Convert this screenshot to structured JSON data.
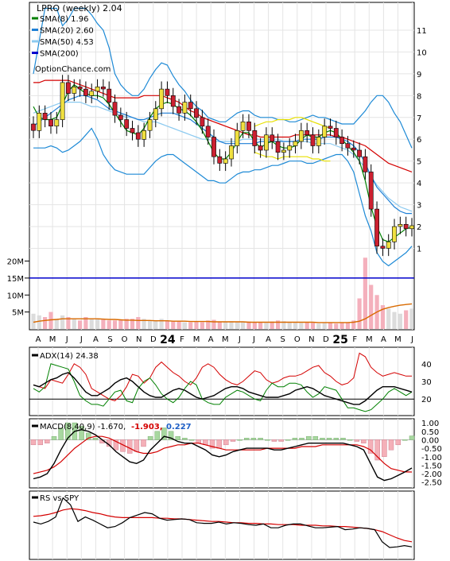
{
  "chart_data": {
    "type": "financial-composite",
    "ticker_label": "LPRO (weekly) 2.04",
    "watermark": "OptionChance.com",
    "colors": {
      "sma8": "#008000",
      "sma20": "#1e7fd6",
      "sma50": "#8ccaf0",
      "sma200": "#0000cc",
      "bb_upper_lower": "#1e8ad6",
      "envelope": "#e8e000",
      "red_line": "#d40000",
      "volume_avg": "#d96a00",
      "up_candle": "#f0e040",
      "down_candle": "#cc2030"
    },
    "x_axis": {
      "labels": [
        "A",
        "M",
        "J",
        "J",
        "A",
        "S",
        "O",
        "N",
        "D",
        "24",
        "F",
        "M",
        "A",
        "M",
        "J",
        "J",
        "A",
        "S",
        "O",
        "N",
        "D",
        "25",
        "F",
        "M",
        "A",
        "M",
        "J"
      ],
      "bold": [
        "24",
        "25"
      ]
    },
    "price_panel": {
      "legend": [
        {
          "label": "SMA(8) 1.96",
          "color": "#008000"
        },
        {
          "label": "SMA(20) 2.60",
          "color": "#1e7fd6"
        },
        {
          "label": "SMA(50) 4.53",
          "color": "#8ccaf0"
        },
        {
          "label": "SMA(200)",
          "color": "#0000cc"
        }
      ],
      "y_ticks": [
        "1",
        "2",
        "3",
        "4",
        "5",
        "6",
        "7",
        "8",
        "9",
        "10",
        "11"
      ],
      "y_range": [
        0,
        12.2
      ],
      "close": [
        6.4,
        7.2,
        6.9,
        6.6,
        6.9,
        8.6,
        8.1,
        8.4,
        8.3,
        8.0,
        8.2,
        8.4,
        8.3,
        7.7,
        7.1,
        6.9,
        6.5,
        6.3,
        6.0,
        6.4,
        6.9,
        7.4,
        8.3,
        8.0,
        7.5,
        7.2,
        7.7,
        7.4,
        7.0,
        6.6,
        6.1,
        5.2,
        4.9,
        5.1,
        5.7,
        6.4,
        6.8,
        6.4,
        5.7,
        5.5,
        6.2,
        5.9,
        5.4,
        5.5,
        5.7,
        5.9,
        6.4,
        6.2,
        5.7,
        6.1,
        6.6,
        6.5,
        6.1,
        5.8,
        5.6,
        5.5,
        5.2,
        4.5,
        2.8,
        1.1,
        1.0,
        1.3,
        2.0,
        2.1,
        1.9,
        2.04
      ],
      "sma8": [
        7.5,
        7.0,
        6.9,
        6.9,
        7.0,
        7.6,
        8.2,
        8.5,
        8.3,
        8.1,
        8.0,
        8.0,
        7.9,
        7.6,
        7.2,
        6.8,
        6.4,
        6.3,
        6.2,
        6.5,
        7.0,
        7.4,
        7.6,
        7.7,
        7.6,
        7.4,
        7.3,
        7.1,
        6.8,
        6.4,
        5.9,
        5.4,
        5.1,
        5.1,
        5.4,
        5.9,
        6.3,
        6.3,
        5.9,
        5.6,
        5.8,
        5.9,
        5.7,
        5.6,
        5.6,
        5.7,
        6.0,
        6.2,
        6.1,
        6.1,
        6.3,
        6.4,
        6.3,
        6.0,
        5.7,
        5.4,
        5.0,
        4.1,
        2.9,
        2.0,
        1.4,
        1.3,
        1.5,
        1.7,
        1.9,
        1.96
      ],
      "sma20": [
        6.6,
        6.8,
        7.0,
        7.2,
        7.4,
        7.6,
        7.8,
        7.9,
        8.0,
        8.0,
        7.9,
        7.8,
        7.6,
        7.4,
        7.3,
        7.2,
        7.1,
        7.0,
        6.9,
        6.9,
        7.0,
        7.1,
        7.2,
        7.2,
        7.2,
        7.1,
        7.0,
        6.9,
        6.7,
        6.5,
        6.3,
        6.1,
        5.9,
        5.8,
        5.8,
        5.8,
        5.8,
        5.8,
        5.8,
        5.9,
        5.9,
        5.9,
        5.9,
        5.9,
        5.9,
        5.9,
        6.0,
        6.0,
        6.0,
        6.0,
        6.1,
        6.1,
        6.1,
        6.0,
        5.9,
        5.7,
        5.4,
        4.9,
        4.3,
        3.8,
        3.5,
        3.2,
        2.9,
        2.7,
        2.6,
        2.6
      ],
      "sma50": [
        7.2,
        7.3,
        7.4,
        7.5,
        7.6,
        7.7,
        7.7,
        7.7,
        7.7,
        7.6,
        7.5,
        7.5,
        7.4,
        7.3,
        7.2,
        7.1,
        7.0,
        7.0,
        6.9,
        6.8,
        6.8,
        6.8,
        6.7,
        6.6,
        6.5,
        6.4,
        6.3,
        6.2,
        6.1,
        6.0,
        6.0,
        5.9,
        5.9,
        5.9,
        5.9,
        5.9,
        6.0,
        6.0,
        6.0,
        6.0,
        6.0,
        6.0,
        6.0,
        5.9,
        5.9,
        5.9,
        5.9,
        5.9,
        5.8,
        5.8,
        5.8,
        5.8,
        5.7,
        5.6,
        5.5,
        5.3,
        5.0,
        4.7,
        4.3,
        3.9,
        3.6,
        3.3,
        3.1,
        2.9,
        2.8,
        2.7
      ],
      "red_line": [
        8.6,
        8.6,
        8.7,
        8.7,
        8.7,
        8.7,
        8.7,
        8.6,
        8.5,
        8.4,
        8.3,
        8.2,
        8.1,
        8.0,
        7.9,
        7.9,
        7.9,
        7.9,
        7.9,
        8.0,
        8.0,
        8.0,
        8.0,
        7.9,
        7.8,
        7.7,
        7.5,
        7.3,
        7.2,
        7.0,
        6.9,
        6.8,
        6.7,
        6.6,
        6.5,
        6.4,
        6.3,
        6.2,
        6.2,
        6.1,
        6.1,
        6.1,
        6.1,
        6.1,
        6.1,
        6.2,
        6.2,
        6.2,
        6.2,
        6.2,
        6.2,
        6.2,
        6.1,
        6.1,
        6.0,
        5.9,
        5.8,
        5.7,
        5.5,
        5.3,
        5.1,
        4.9,
        4.8,
        4.7,
        4.6,
        4.5
      ],
      "bb_upper": [
        9.0,
        10.5,
        12.0,
        12.0,
        12.0,
        11.2,
        11.5,
        12.0,
        12.0,
        12.0,
        11.7,
        11.3,
        11.0,
        10.2,
        9.0,
        8.5,
        8.2,
        8.0,
        8.0,
        8.3,
        8.8,
        9.2,
        9.5,
        9.4,
        8.9,
        8.5,
        8.2,
        7.8,
        7.5,
        7.3,
        7.0,
        6.9,
        6.8,
        6.8,
        7.0,
        7.2,
        7.3,
        7.3,
        7.1,
        7.0,
        7.0,
        7.0,
        6.9,
        6.9,
        6.8,
        6.8,
        6.9,
        7.0,
        7.1,
        7.0,
        7.0,
        6.9,
        6.8,
        6.7,
        6.7,
        6.7,
        7.0,
        7.3,
        7.7,
        8.0,
        8.0,
        7.7,
        7.2,
        6.8,
        6.2,
        5.6
      ],
      "bb_lower": [
        5.6,
        5.6,
        5.6,
        5.7,
        5.6,
        5.4,
        5.5,
        5.7,
        5.9,
        6.2,
        6.5,
        6.0,
        5.3,
        4.9,
        4.6,
        4.5,
        4.4,
        4.4,
        4.4,
        4.4,
        4.7,
        5.0,
        5.2,
        5.3,
        5.3,
        5.1,
        4.9,
        4.7,
        4.5,
        4.3,
        4.1,
        4.1,
        4.0,
        4.0,
        4.2,
        4.4,
        4.5,
        4.5,
        4.6,
        4.6,
        4.7,
        4.8,
        4.8,
        4.9,
        5.0,
        5.0,
        5.0,
        4.9,
        4.9,
        5.0,
        5.1,
        5.2,
        5.3,
        5.3,
        5.0,
        4.5,
        3.5,
        2.5,
        1.8,
        0.8,
        0.4,
        0.2,
        0.4,
        0.6,
        0.8,
        1.1
      ],
      "envelope_upper": [
        6.6,
        6.7,
        6.8,
        6.8,
        6.9,
        6.9,
        6.9,
        7.0,
        7.0,
        6.9,
        6.8,
        6.7,
        6.6,
        6.5
      ],
      "envelope_lower": [
        5.4,
        5.3,
        5.2,
        5.2,
        5.1,
        5.2,
        5.2,
        5.2,
        5.2,
        5.2,
        5.1,
        5.1,
        5.0,
        5.0
      ],
      "envelope_start": 38,
      "sma200_level_M": 15
    },
    "volume_panel": {
      "y_ticks": [
        "5M",
        "10M",
        "15M",
        "20M"
      ],
      "y_range_M": [
        0,
        22
      ],
      "values_M": [
        4.5,
        4.0,
        3.5,
        5.0,
        3.0,
        4.0,
        3.5,
        3.0,
        2.5,
        3.5,
        3.0,
        3.0,
        2.8,
        2.5,
        2.5,
        2.8,
        3.0,
        3.0,
        3.5,
        3.0,
        2.5,
        2.5,
        3.0,
        2.5,
        2.2,
        2.3,
        2.0,
        2.0,
        2.3,
        2.0,
        2.5,
        2.7,
        2.2,
        2.0,
        2.3,
        2.0,
        2.0,
        2.2,
        2.0,
        2.0,
        1.8,
        2.2,
        2.5,
        2.3,
        2.0,
        1.8,
        1.8,
        2.0,
        1.8,
        1.6,
        1.7,
        2.0,
        1.6,
        1.8,
        2.0,
        2.5,
        9.0,
        21.0,
        13.0,
        10.0,
        7.0,
        6.0,
        5.0,
        4.5,
        5.5,
        6.0
      ],
      "avg_M": [
        2.0,
        2.3,
        2.5,
        2.7,
        2.8,
        3.0,
        3.0,
        3.0,
        3.0,
        3.0,
        3.0,
        3.0,
        2.9,
        2.8,
        2.8,
        2.7,
        2.6,
        2.6,
        2.5,
        2.5,
        2.5,
        2.4,
        2.4,
        2.4,
        2.3,
        2.3,
        2.3,
        2.2,
        2.2,
        2.2,
        2.2,
        2.1,
        2.1,
        2.1,
        2.1,
        2.1,
        2.1,
        2.0,
        2.0,
        2.0,
        2.0,
        2.0,
        2.0,
        2.0,
        2.0,
        2.0,
        2.0,
        2.0,
        2.0,
        1.9,
        1.9,
        1.9,
        1.9,
        1.9,
        1.9,
        2.0,
        2.3,
        3.0,
        4.0,
        5.0,
        5.8,
        6.3,
        6.7,
        7.0,
        7.2,
        7.4
      ]
    },
    "adx_panel": {
      "label": "ADX(14) 24.38",
      "y_ticks": [
        "20",
        "30",
        "40"
      ],
      "y_range": [
        12,
        48
      ],
      "adx": [
        28,
        27,
        29,
        31,
        32,
        34,
        35,
        32,
        28,
        24,
        22,
        22,
        24,
        26,
        29,
        31,
        32,
        30,
        27,
        24,
        22,
        21,
        21,
        23,
        25,
        26,
        25,
        23,
        21,
        20,
        21,
        22,
        24,
        26,
        27,
        27,
        26,
        24,
        23,
        22,
        21,
        21,
        21,
        22,
        23,
        25,
        26,
        27,
        26,
        24,
        22,
        21,
        20,
        19,
        18,
        17,
        17,
        19,
        22,
        25,
        27,
        27,
        27,
        26,
        25,
        24
      ],
      "plus_di": [
        26,
        24,
        27,
        40,
        39,
        38,
        37,
        30,
        22,
        19,
        17,
        17,
        16,
        20,
        24,
        25,
        19,
        18,
        26,
        30,
        32,
        28,
        23,
        20,
        18,
        21,
        26,
        30,
        28,
        20,
        18,
        17,
        17,
        21,
        23,
        25,
        24,
        22,
        20,
        19,
        25,
        29,
        27,
        27,
        29,
        29,
        28,
        24,
        21,
        23,
        27,
        26,
        25,
        20,
        15,
        15,
        14,
        13,
        14,
        17,
        20,
        24,
        26,
        24,
        22,
        24
      ],
      "minus_di": [
        28,
        27,
        26,
        31,
        30,
        29,
        34,
        40,
        38,
        34,
        26,
        24,
        22,
        20,
        19,
        22,
        27,
        34,
        33,
        29,
        32,
        38,
        41,
        38,
        35,
        33,
        30,
        28,
        32,
        38,
        40,
        38,
        34,
        31,
        29,
        28,
        30,
        33,
        36,
        35,
        31,
        29,
        30,
        32,
        33,
        33,
        34,
        36,
        38,
        39,
        35,
        33,
        30,
        28,
        29,
        32,
        46,
        44,
        38,
        35,
        33,
        34,
        35,
        34,
        33,
        33
      ]
    },
    "macd_panel": {
      "label": "MACD(8,40,9) -1.670,",
      "signal_value": "-1.903,",
      "hist_value": "0.227",
      "y_ticks": [
        "1.00",
        "0.50",
        "0.00",
        "-0.50",
        "-1.00",
        "-1.50",
        "-2.00",
        "-2.50"
      ],
      "y_range": [
        -2.7,
        1.1
      ],
      "macd": [
        -2.3,
        -2.2,
        -2.0,
        -1.4,
        -0.6,
        0.1,
        0.5,
        0.6,
        0.5,
        0.3,
        0.0,
        -0.3,
        -0.7,
        -1.0,
        -1.3,
        -1.4,
        -1.2,
        -0.6,
        -0.2,
        0.2,
        0.1,
        -0.1,
        -0.2,
        -0.2,
        -0.4,
        -0.6,
        -0.9,
        -1.0,
        -0.9,
        -0.7,
        -0.6,
        -0.5,
        -0.5,
        -0.5,
        -0.5,
        -0.6,
        -0.6,
        -0.5,
        -0.4,
        -0.3,
        -0.2,
        -0.2,
        -0.2,
        -0.2,
        -0.2,
        -0.2,
        -0.3,
        -0.4,
        -0.6,
        -1.4,
        -2.2,
        -2.4,
        -2.3,
        -2.1,
        -1.9,
        -1.67
      ],
      "signal": [
        -2.0,
        -1.9,
        -1.8,
        -1.6,
        -1.3,
        -0.9,
        -0.5,
        -0.2,
        0.1,
        0.2,
        0.2,
        0.1,
        -0.1,
        -0.3,
        -0.5,
        -0.7,
        -0.8,
        -0.8,
        -0.7,
        -0.5,
        -0.4,
        -0.3,
        -0.3,
        -0.2,
        -0.2,
        -0.3,
        -0.4,
        -0.5,
        -0.6,
        -0.6,
        -0.6,
        -0.6,
        -0.6,
        -0.6,
        -0.5,
        -0.5,
        -0.5,
        -0.5,
        -0.5,
        -0.4,
        -0.4,
        -0.4,
        -0.3,
        -0.3,
        -0.3,
        -0.3,
        -0.3,
        -0.3,
        -0.4,
        -0.6,
        -1.0,
        -1.4,
        -1.7,
        -1.8,
        -1.9,
        -1.903
      ],
      "histogram": [
        -0.3,
        -0.3,
        -0.2,
        0.2,
        0.7,
        1.0,
        1.0,
        0.8,
        0.4,
        0.1,
        -0.2,
        -0.4,
        -0.6,
        -0.7,
        -0.8,
        -0.7,
        -0.4,
        0.2,
        0.5,
        0.7,
        0.5,
        0.2,
        0.1,
        0.0,
        -0.2,
        -0.3,
        -0.5,
        -0.5,
        -0.3,
        -0.1,
        0.0,
        0.1,
        0.1,
        0.1,
        0.0,
        -0.1,
        -0.1,
        0.0,
        0.1,
        0.1,
        0.2,
        0.2,
        0.1,
        0.1,
        0.1,
        0.1,
        0.0,
        -0.1,
        -0.2,
        -0.8,
        -1.2,
        -1.0,
        -0.6,
        -0.3,
        0.0,
        0.227
      ]
    },
    "rs_panel": {
      "label": "RS vs SPY",
      "y_range": [
        0,
        10
      ],
      "rs": [
        5.5,
        5.2,
        5.6,
        6.3,
        9.3,
        8.2,
        5.6,
        6.3,
        5.8,
        5.2,
        4.6,
        4.8,
        5.4,
        6.2,
        6.6,
        7.0,
        6.8,
        6.1,
        5.8,
        5.9,
        6.0,
        5.9,
        5.4,
        5.3,
        5.3,
        5.5,
        5.2,
        5.4,
        5.3,
        5.1,
        5.0,
        5.2,
        4.6,
        4.6,
        5.0,
        5.2,
        5.2,
        4.9,
        4.6,
        4.6,
        4.7,
        4.8,
        4.3,
        4.4,
        4.6,
        4.5,
        4.3,
        2.4,
        1.5,
        1.6,
        1.8,
        1.6
      ],
      "rs_avg": [
        6.4,
        6.5,
        6.7,
        7.0,
        7.4,
        7.6,
        7.5,
        7.3,
        7.0,
        6.8,
        6.5,
        6.3,
        6.2,
        6.2,
        6.2,
        6.2,
        6.2,
        6.1,
        6.1,
        6.0,
        6.0,
        5.9,
        5.8,
        5.7,
        5.6,
        5.6,
        5.5,
        5.4,
        5.4,
        5.3,
        5.3,
        5.2,
        5.2,
        5.1,
        5.1,
        5.1,
        5.0,
        5.0,
        5.0,
        4.9,
        4.9,
        4.8,
        4.8,
        4.7,
        4.6,
        4.5,
        4.3,
        4.0,
        3.5,
        3.0,
        2.6,
        2.4
      ]
    }
  }
}
